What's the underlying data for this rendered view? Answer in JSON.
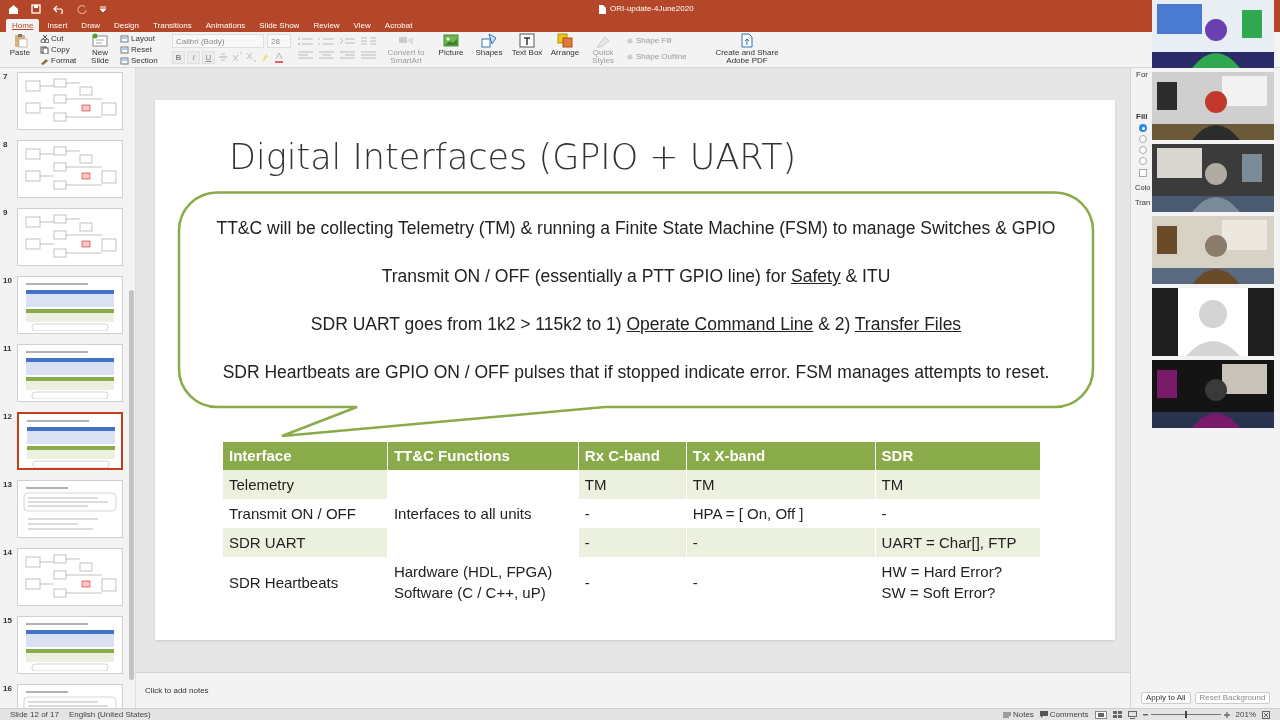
{
  "window": {
    "title": "ORI-update-4June2020"
  },
  "tabs": [
    {
      "label": "Home",
      "selected": true
    },
    {
      "label": "Insert",
      "selected": false
    },
    {
      "label": "Draw",
      "selected": false
    },
    {
      "label": "Design",
      "selected": false
    },
    {
      "label": "Transitions",
      "selected": false
    },
    {
      "label": "Animations",
      "selected": false
    },
    {
      "label": "Slide Show",
      "selected": false
    },
    {
      "label": "Review",
      "selected": false
    },
    {
      "label": "View",
      "selected": false
    },
    {
      "label": "Acrobat",
      "selected": false
    }
  ],
  "ribbon": {
    "paste": "Paste",
    "clipboard": [
      "Cut",
      "Copy",
      "Format"
    ],
    "new_slide": "New Slide",
    "slide_actions": [
      "Layout",
      "Reset",
      "Section"
    ],
    "font_name": {
      "placeholder": "Calibri (Body)",
      "disabled": true
    },
    "font_size": {
      "placeholder": "28",
      "disabled": true
    },
    "format_buttons": [
      "B",
      "I",
      "U"
    ],
    "large_buttons": [
      {
        "label": "Convert to SmartArt",
        "disabled": true,
        "kind": "smartart"
      },
      {
        "label": "Picture",
        "disabled": false,
        "kind": "picture"
      },
      {
        "label": "Shapes",
        "disabled": false,
        "kind": "shapes"
      },
      {
        "label": "Text Box",
        "disabled": false,
        "kind": "textbox"
      },
      {
        "label": "Arrange",
        "disabled": false,
        "kind": "arrange"
      },
      {
        "label": "Quick Styles",
        "disabled": true,
        "kind": "styles"
      }
    ],
    "shape_buttons": [
      {
        "label": "Shape Fill",
        "disabled": true
      },
      {
        "label": "Shape Outline",
        "disabled": true
      }
    ],
    "pdf_button": "Create and Share Adobe PDF"
  },
  "thumbnails": [
    {
      "number": "7",
      "kind": "diagram",
      "selected": false
    },
    {
      "number": "8",
      "kind": "diagram",
      "selected": false
    },
    {
      "number": "9",
      "kind": "diagram",
      "selected": false
    },
    {
      "number": "10",
      "kind": "table",
      "selected": false
    },
    {
      "number": "11",
      "kind": "table",
      "selected": false
    },
    {
      "number": "12",
      "kind": "table",
      "selected": true
    },
    {
      "number": "13",
      "kind": "bullets",
      "selected": false
    },
    {
      "number": "14",
      "kind": "diagram",
      "selected": false
    },
    {
      "number": "15",
      "kind": "table",
      "selected": false
    },
    {
      "number": "16",
      "kind": "bullets",
      "selected": false
    }
  ],
  "slide": {
    "title": "Digital Interfaces (GPIO + UART)",
    "callout_lines": [
      [
        {
          "text": "TT&C will be collecting Telemetry (TM) & running a Finite State Machine (FSM) to manage Switches & GPIO",
          "underline": false
        }
      ],
      [
        {
          "text": "Transmit ON / OFF (essentially a PTT GPIO line) for ",
          "underline": false
        },
        {
          "text": "Safety",
          "underline": true
        },
        {
          "text": " & ITU",
          "underline": false
        }
      ],
      [
        {
          "text": "SDR UART goes from 1k2 > 115k2 to 1) ",
          "underline": false
        },
        {
          "text": "Operate Command Line",
          "underline": true
        },
        {
          "text": " & 2) ",
          "underline": false
        },
        {
          "text": "Transfer Files",
          "underline": true
        }
      ],
      [
        {
          "text": "SDR Heartbeats are GPIO ON / OFF pulses that if stopped indicate error. FSM manages attempts to reset.",
          "underline": false
        }
      ]
    ],
    "table": {
      "columns": [
        "Interface",
        "TT&C Functions",
        "Rx C-band",
        "Tx X-band",
        "SDR"
      ],
      "rows": [
        {
          "shaded": true,
          "cells": [
            {
              "lines": [
                "Telemetry"
              ]
            },
            {
              "lines": [
                "Interfaces to all units"
              ],
              "rowspan": 3
            },
            {
              "lines": [
                "TM"
              ]
            },
            {
              "lines": [
                "TM"
              ]
            },
            {
              "lines": [
                "TM"
              ]
            }
          ]
        },
        {
          "shaded": false,
          "cells": [
            {
              "lines": [
                "Transmit ON / OFF"
              ]
            },
            {
              "lines": [
                "-"
              ]
            },
            {
              "lines": [
                "HPA = [ On, Off ]"
              ]
            },
            {
              "lines": [
                "-"
              ]
            }
          ]
        },
        {
          "shaded": true,
          "cells": [
            {
              "lines": [
                "SDR UART"
              ]
            },
            {
              "lines": [
                "-"
              ]
            },
            {
              "lines": [
                "-"
              ]
            },
            {
              "lines": [
                "UART = Char[], FTP"
              ]
            }
          ]
        },
        {
          "shaded": false,
          "cells": [
            {
              "lines": [
                "SDR Heartbeats"
              ]
            },
            {
              "lines": [
                "Hardware (HDL, FPGA)",
                "Software (C / C++, uP)"
              ]
            },
            {
              "lines": [
                "-"
              ]
            },
            {
              "lines": [
                "-"
              ]
            },
            {
              "lines": [
                "HW = Hard Error?",
                "SW = Soft Error?"
              ]
            }
          ]
        }
      ]
    }
  },
  "notes": {
    "placeholder": "Click to add notes"
  },
  "format_pane": {
    "title": "For",
    "section": "Fill",
    "fill_options": [
      {
        "selected": true
      },
      {
        "selected": false
      },
      {
        "selected": false
      },
      {
        "selected": false
      }
    ],
    "hide_checkbox": {
      "checked": false
    },
    "labels": [
      "Colo",
      "Tran"
    ],
    "buttons": [
      "Apply to All",
      "Reset Background"
    ]
  },
  "video_tiles": [
    {
      "kind": "picture"
    },
    {
      "kind": "picture"
    },
    {
      "kind": "picture"
    },
    {
      "kind": "picture"
    },
    {
      "kind": "avatar"
    },
    {
      "kind": "picture"
    }
  ],
  "status_bar": {
    "slide_position": "Slide 12 of 17",
    "language": "English (United States)",
    "notes": "Notes",
    "comments": "Comments",
    "zoom_slider": {
      "level": 0.5
    },
    "zoom": "201%"
  }
}
